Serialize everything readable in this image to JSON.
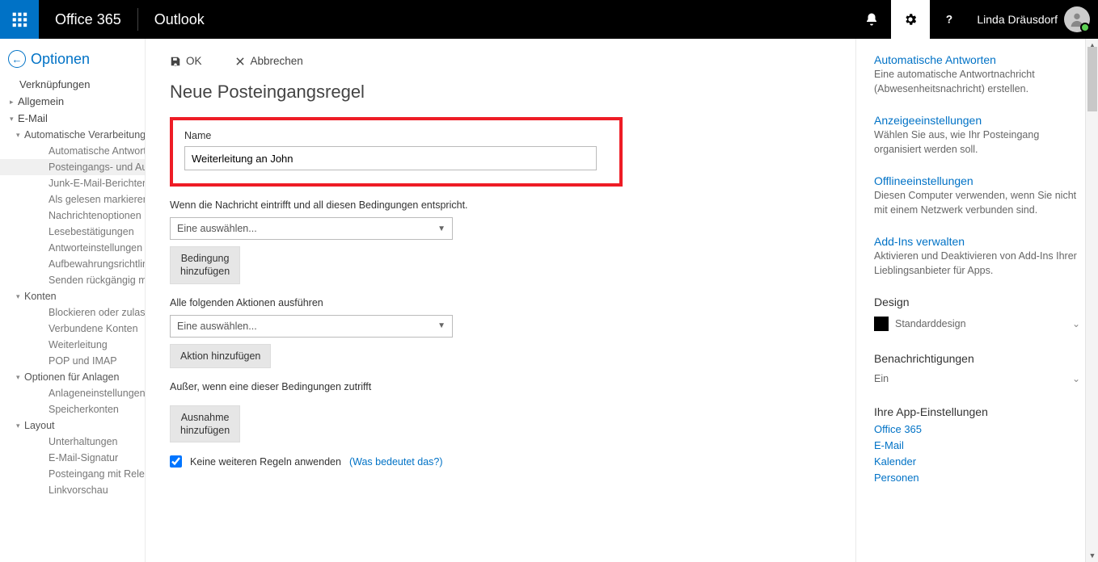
{
  "header": {
    "brand": "Office 365",
    "app": "Outlook",
    "user": "Linda Dräusdorf"
  },
  "sidebar": {
    "back_label": "Optionen",
    "shortcuts": "Verknüpfungen",
    "general": "Allgemein",
    "email": "E-Mail",
    "auto_proc": "Automatische Verarbeitung",
    "auto_replies": "Automatische Antworten",
    "inbox_rules": "Posteingangs- und Aufräumregeln",
    "junk_reports": "Junk-E-Mail-Berichterstellung",
    "mark_read": "Als gelesen markieren",
    "msg_options": "Nachrichtenoptionen",
    "read_receipts": "Lesebestätigungen",
    "reply_settings": "Antworteinstellungen",
    "retention": "Aufbewahrungsrichtlinien",
    "undo_send": "Senden rückgängig machen",
    "accounts": "Konten",
    "block_allow": "Blockieren oder zulassen",
    "connected": "Verbundene Konten",
    "forwarding": "Weiterleitung",
    "pop_imap": "POP und IMAP",
    "attach_opts": "Optionen für Anlagen",
    "attach_settings": "Anlageneinstellungen",
    "storage": "Speicherkonten",
    "layout": "Layout",
    "conversations": "Unterhaltungen",
    "signature": "E-Mail-Signatur",
    "inbox_relevance": "Posteingang mit Relevanz",
    "link_preview": "Linkvorschau"
  },
  "main": {
    "ok": "OK",
    "cancel": "Abbrechen",
    "title": "Neue Posteingangsregel",
    "name_label": "Name",
    "name_value": "Weiterleitung an John",
    "condition_label": "Wenn die Nachricht eintrifft und all diesen Bedingungen entspricht.",
    "select_placeholder": "Eine auswählen...",
    "add_condition": "Bedingung\nhinzufügen",
    "actions_label": "Alle folgenden Aktionen ausführen",
    "add_action": "Aktion hinzufügen",
    "except_label": "Außer, wenn eine dieser Bedingungen zutrifft",
    "add_exception": "Ausnahme\nhinzufügen",
    "stop_rules": "Keine weiteren Regeln anwenden",
    "what_means": "(Was bedeutet das?)"
  },
  "panel": {
    "auto_reply_title": "Automatische Antworten",
    "auto_reply_desc": "Eine automatische Antwortnachricht (Abwesenheitsnachricht) erstellen.",
    "display_title": "Anzeigeeinstellungen",
    "display_desc": "Wählen Sie aus, wie Ihr Posteingang organisiert werden soll.",
    "offline_title": "Offlineeinstellungen",
    "offline_desc": "Diesen Computer verwenden, wenn Sie nicht mit einem Netzwerk verbunden sind.",
    "addins_title": "Add-Ins verwalten",
    "addins_desc": "Aktivieren und Deaktivieren von Add-Ins Ihrer Lieblingsanbieter für Apps.",
    "design_heading": "Design",
    "design_value": "Standarddesign",
    "notif_heading": "Benachrichtigungen",
    "notif_value": "Ein",
    "app_settings_heading": "Ihre App-Einstellungen",
    "links": {
      "o365": "Office 365",
      "mail": "E-Mail",
      "cal": "Kalender",
      "people": "Personen"
    }
  }
}
